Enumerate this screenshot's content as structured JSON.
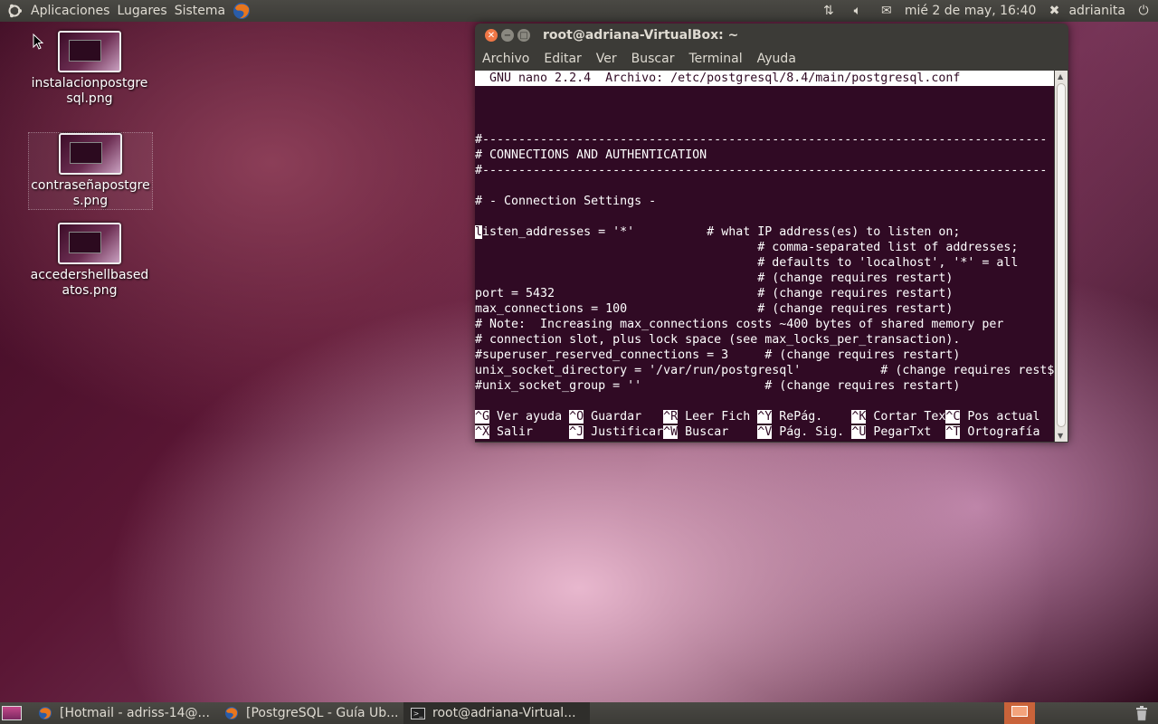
{
  "top_panel": {
    "menus": [
      "Aplicaciones",
      "Lugares",
      "Sistema"
    ],
    "datetime": "mié 2 de may, 16:40",
    "user": "adrianita"
  },
  "desktop_icons": [
    {
      "label": "instalacionpostgresql.png"
    },
    {
      "label": "contraseñapostgres.png"
    },
    {
      "label": "accedershellbasedatos.png"
    }
  ],
  "terminal": {
    "title": "root@adriana-VirtualBox: ~",
    "menu": [
      "Archivo",
      "Editar",
      "Ver",
      "Buscar",
      "Terminal",
      "Ayuda"
    ],
    "nano_header": "  GNU nano 2.2.4  Archivo: /etc/postgresql/8.4/main/postgresql.conf",
    "lines": [
      "",
      "",
      "",
      "#------------------------------------------------------------------------------",
      "# CONNECTIONS AND AUTHENTICATION",
      "#------------------------------------------------------------------------------",
      "",
      "# - Connection Settings -",
      "",
      "isten_addresses = '*'          # what IP address(es) to listen on;",
      "                                       # comma-separated list of addresses;",
      "                                       # defaults to 'localhost', '*' = all",
      "                                       # (change requires restart)",
      "port = 5432                            # (change requires restart)",
      "max_connections = 100                  # (change requires restart)",
      "# Note:  Increasing max_connections costs ~400 bytes of shared memory per",
      "# connection slot, plus lock space (see max_locks_per_transaction).",
      "#superuser_reserved_connections = 3     # (change requires restart)",
      "unix_socket_directory = '/var/run/postgresql'           # (change requires rest$",
      "#unix_socket_group = ''                 # (change requires restart)",
      ""
    ],
    "cursor_char": "l",
    "shortcuts_row1": [
      {
        "key": "^G",
        "label": " Ver ayuda "
      },
      {
        "key": "^O",
        "label": " Guardar   "
      },
      {
        "key": "^R",
        "label": " Leer Fich "
      },
      {
        "key": "^Y",
        "label": " RePág.    "
      },
      {
        "key": "^K",
        "label": " Cortar Tex"
      },
      {
        "key": "^C",
        "label": " Pos actual"
      }
    ],
    "shortcuts_row2": [
      {
        "key": "^X",
        "label": " Salir     "
      },
      {
        "key": "^J",
        "label": " Justificar"
      },
      {
        "key": "^W",
        "label": " Buscar    "
      },
      {
        "key": "^V",
        "label": " Pág. Sig. "
      },
      {
        "key": "^U",
        "label": " PegarTxt  "
      },
      {
        "key": "^T",
        "label": " Ortografía"
      }
    ]
  },
  "taskbar": [
    {
      "label": "[Hotmail - adriss-14@..."
    },
    {
      "label": "[PostgreSQL - Guía Ub..."
    },
    {
      "label": "root@adriana-Virtual..."
    }
  ],
  "colors": {
    "terminal_bg": "#300a24",
    "panel_bg": "#3c3b37",
    "close_button": "#f07746"
  }
}
